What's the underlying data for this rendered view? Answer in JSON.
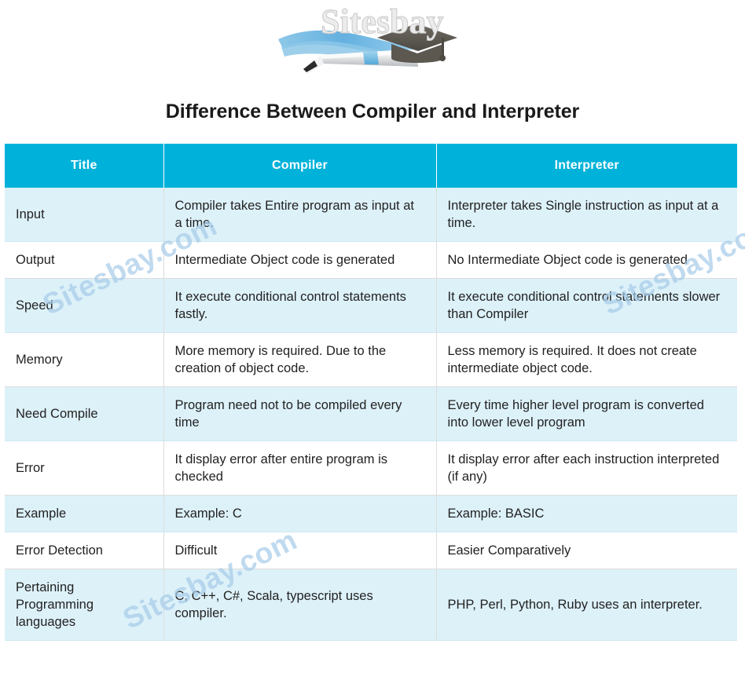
{
  "logo": {
    "brand_text": "Sitesbay",
    "icons": [
      "pencil-icon",
      "graduation-cap-icon",
      "swoosh-icon"
    ],
    "colors": {
      "swoosh": "#5aa7d8",
      "cap": "#5e5a53",
      "pencil_body": "#e3e5e7",
      "pencil_band": "#73bde4",
      "wordmark": "#e8e8e8"
    }
  },
  "page": {
    "title": "Difference Between Compiler and Interpreter"
  },
  "colors": {
    "header_bg": "#00b2da",
    "header_text": "#ffffff",
    "row_tint": "#ddf1f9",
    "row_plain": "#ffffff",
    "body_text": "#222222",
    "border": "#dcdcdc",
    "watermark": "#a8cde9"
  },
  "watermarks": [
    {
      "text": "Sitesbay.com"
    },
    {
      "text": "Sitesbay.com"
    },
    {
      "text": "Sitesbay.com"
    }
  ],
  "table": {
    "columns": [
      "Title",
      "Compiler",
      "Interpreter"
    ],
    "rows": [
      {
        "title": "Input",
        "compiler": "Compiler takes Entire program as input at a time.",
        "interpreter": "Interpreter takes Single instruction as input at a time."
      },
      {
        "title": "Output",
        "compiler": "Intermediate Object code is generated",
        "interpreter": "No Intermediate Object code is generated"
      },
      {
        "title": "Speed",
        "compiler": "It execute conditional control statements fastly.",
        "interpreter": "It execute conditional control statements slower than Compiler"
      },
      {
        "title": "Memory",
        "compiler": "More memory is required. Due to the creation of object code.",
        "interpreter": "Less memory is required. It does not create intermediate object code."
      },
      {
        "title": "Need Compile",
        "compiler": "Program need not to be compiled every time",
        "interpreter": "Every time higher level program is converted into lower level program"
      },
      {
        "title": "Error",
        "compiler": "It display error after entire program is checked",
        "interpreter": "It display error after each instruction interpreted (if any)"
      },
      {
        "title": "Example",
        "compiler": "Example: C",
        "interpreter": "Example: BASIC"
      },
      {
        "title": "Error Detection",
        "compiler": "Difficult",
        "interpreter": "Easier Comparatively"
      },
      {
        "title": "Pertaining Programming languages",
        "compiler": "C, C++, C#, Scala, typescript uses compiler.",
        "interpreter": "PHP, Perl, Python, Ruby uses an interpreter."
      }
    ]
  }
}
